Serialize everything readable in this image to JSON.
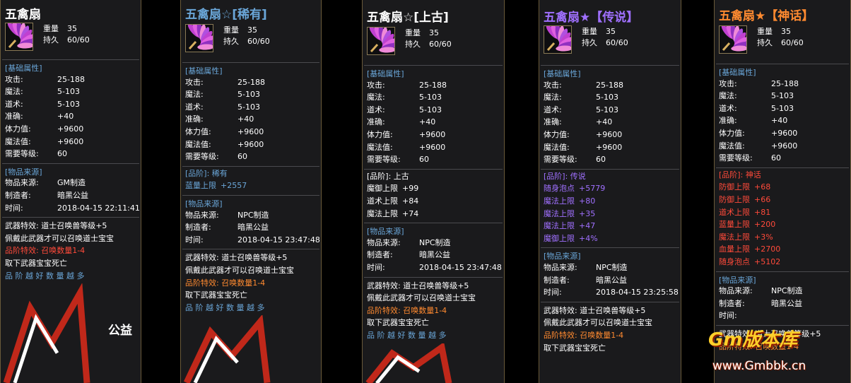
{
  "colors": {
    "white": "#ffffff",
    "blue": "#6aa6d8",
    "purple": "#a070ff",
    "orange": "#ff8a30",
    "red": "#ff4a3a",
    "cyan_title": "#8ab8ff"
  },
  "icon_name": "feather-fan-icon",
  "panels": [
    {
      "title": "五禽扇",
      "title_color": "#ffffff",
      "weight_label": "重量",
      "weight": "35",
      "durability_label": "持久",
      "durability": "60/60",
      "base_header": "[基础属性]",
      "stats": [
        {
          "label": "攻击:",
          "value": "25-188"
        },
        {
          "label": "魔法:",
          "value": "5-103"
        },
        {
          "label": "道术:",
          "value": "5-103"
        },
        {
          "label": "准确:",
          "value": "+40"
        },
        {
          "label": "体力值:",
          "value": "+9600"
        },
        {
          "label": "魔法值:",
          "value": "+9600"
        },
        {
          "label": "需要等级:",
          "value": "60"
        }
      ],
      "grade_lines": [],
      "source_header": "[物品来源]",
      "source": [
        {
          "label": "物品来源:",
          "value": "GM制造"
        },
        {
          "label": "制造者:",
          "value": "暗黑公益"
        },
        {
          "label": "时间:",
          "value": "2018-04-15 22:11:41"
        }
      ],
      "effects": [
        {
          "text": "武器特效: 道士召唤兽等级+5",
          "color": "#ffffff"
        },
        {
          "text": "佩戴此武器才可以召唤道士宝宝",
          "color": "#ffffff"
        },
        {
          "text": "品阶特效: 召唤数量1-4",
          "color": "#ff4a3a"
        },
        {
          "text": "取下武器宝宝死亡",
          "color": "#ffffff"
        },
        {
          "text": "品 阶 越 好 数 量 越 多",
          "color": "#6aa6d8"
        }
      ],
      "art_text": "公益"
    },
    {
      "title": "五禽扇☆[稀有]",
      "title_color": "#6aa6d8",
      "weight_label": "重量",
      "weight": "35",
      "durability_label": "持久",
      "durability": "60/60",
      "base_header": "[基础属性]",
      "stats": [
        {
          "label": "攻击:",
          "value": "25-188"
        },
        {
          "label": "魔法:",
          "value": "5-103"
        },
        {
          "label": "道术:",
          "value": "5-103"
        },
        {
          "label": "准确:",
          "value": "+40"
        },
        {
          "label": "体力值:",
          "value": "+9600"
        },
        {
          "label": "魔法值:",
          "value": "+9600"
        },
        {
          "label": "需要等级:",
          "value": "60"
        }
      ],
      "grade_lines": [
        {
          "label": "[品阶]: 稀有",
          "value": "",
          "color": "#6aa6d8"
        },
        {
          "label": "蓝量上限",
          "value": "+2557",
          "color": "#6aa6d8"
        }
      ],
      "source_header": "[物品来源]",
      "source": [
        {
          "label": "物品来源:",
          "value": "NPC制造"
        },
        {
          "label": "制造者:",
          "value": "暗黑公益"
        },
        {
          "label": "时间:",
          "value": "2018-04-15 23:47:48"
        }
      ],
      "effects": [
        {
          "text": "武器特效: 道士召唤兽等级+5",
          "color": "#ffffff"
        },
        {
          "text": "佩戴此武器才可以召唤道士宝宝",
          "color": "#ffffff"
        },
        {
          "text": "品阶特效: 召唤数量1-4",
          "color": "#ff8a30"
        },
        {
          "text": "取下武器宝宝死亡",
          "color": "#ffffff"
        },
        {
          "text": "品 阶 越 好 数 量 越 多",
          "color": "#6aa6d8"
        }
      ]
    },
    {
      "title": "五禽扇☆[上古]",
      "title_color": "#ffffff",
      "weight_label": "重量",
      "weight": "35",
      "durability_label": "持久",
      "durability": "60/60",
      "base_header": "[基础属性]",
      "stats": [
        {
          "label": "攻击:",
          "value": "25-188"
        },
        {
          "label": "魔法:",
          "value": "5-103"
        },
        {
          "label": "道术:",
          "value": "5-103"
        },
        {
          "label": "准确:",
          "value": "+40"
        },
        {
          "label": "体力值:",
          "value": "+9600"
        },
        {
          "label": "魔法值:",
          "value": "+9600"
        },
        {
          "label": "需要等级:",
          "value": "60"
        }
      ],
      "grade_lines": [
        {
          "label": "[品阶]: 上古",
          "value": "",
          "color": "#ffffff"
        },
        {
          "label": "魔御上限",
          "value": "+99",
          "color": "#ffffff"
        },
        {
          "label": "道术上限",
          "value": "+84",
          "color": "#ffffff"
        },
        {
          "label": "魔法上限",
          "value": "+74",
          "color": "#ffffff"
        }
      ],
      "source_header": "[物品来源]",
      "source": [
        {
          "label": "物品来源:",
          "value": "NPC制造"
        },
        {
          "label": "制造者:",
          "value": "暗黑公益"
        },
        {
          "label": "时间:",
          "value": "2018-04-15 23:47:48"
        }
      ],
      "effects": [
        {
          "text": "武器特效: 道士召唤兽等级+5",
          "color": "#ffffff"
        },
        {
          "text": "佩戴此武器才可以召唤道士宝宝",
          "color": "#ffffff"
        },
        {
          "text": "品阶特效: 召唤数量1-4",
          "color": "#ff8a30"
        },
        {
          "text": "取下武器宝宝死亡",
          "color": "#ffffff"
        },
        {
          "text": "品 阶 越 好 数 量 越 多",
          "color": "#6aa6d8"
        }
      ]
    },
    {
      "title": "五禽扇★【传说】",
      "title_color": "#a070ff",
      "weight_label": "重量",
      "weight": "35",
      "durability_label": "持久",
      "durability": "60/60",
      "base_header": "[基础属性]",
      "stats": [
        {
          "label": "攻击:",
          "value": "25-188"
        },
        {
          "label": "魔法:",
          "value": "5-103"
        },
        {
          "label": "道术:",
          "value": "5-103"
        },
        {
          "label": "准确:",
          "value": "+40"
        },
        {
          "label": "体力值:",
          "value": "+9600"
        },
        {
          "label": "魔法值:",
          "value": "+9600"
        },
        {
          "label": "需要等级:",
          "value": "60"
        }
      ],
      "grade_lines": [
        {
          "label": "[品阶]: 传说",
          "value": "",
          "color": "#a070ff"
        },
        {
          "label": "随身泡点",
          "value": "+5779",
          "color": "#a070ff"
        },
        {
          "label": "魔法上限",
          "value": "+80",
          "color": "#a070ff"
        },
        {
          "label": "魔法上限",
          "value": "+35",
          "color": "#a070ff"
        },
        {
          "label": "魔法上限",
          "value": "+47",
          "color": "#a070ff"
        },
        {
          "label": "魔御上限",
          "value": "+4%",
          "color": "#a070ff"
        }
      ],
      "source_header": "[物品来源]",
      "source": [
        {
          "label": "物品来源:",
          "value": "NPC制造"
        },
        {
          "label": "制造者:",
          "value": "暗黑公益"
        },
        {
          "label": "时间:",
          "value": "2018-04-15 23:25:58"
        }
      ],
      "effects": [
        {
          "text": "武器特效: 道士召唤兽等级+5",
          "color": "#ffffff"
        },
        {
          "text": "佩戴此武器才可以召唤道士宝宝",
          "color": "#ffffff"
        },
        {
          "text": "品阶特效: 召唤数量1-4",
          "color": "#ff8a30"
        },
        {
          "text": "取下武器宝宝死亡",
          "color": "#ffffff"
        }
      ]
    },
    {
      "title": "五禽扇★【神话】",
      "title_color": "#ff8a30",
      "weight_label": "重量",
      "weight": "35",
      "durability_label": "持久",
      "durability": "60/60",
      "base_header": "[基础属性]",
      "stats": [
        {
          "label": "攻击:",
          "value": "25-188"
        },
        {
          "label": "魔法:",
          "value": "5-103"
        },
        {
          "label": "道术:",
          "value": "5-103"
        },
        {
          "label": "准确:",
          "value": "+40"
        },
        {
          "label": "体力值:",
          "value": "+9600"
        },
        {
          "label": "魔法值:",
          "value": "+9600"
        },
        {
          "label": "需要等级:",
          "value": "60"
        }
      ],
      "grade_lines": [
        {
          "label": "[品阶]: 神话",
          "value": "",
          "color": "#ff4a3a"
        },
        {
          "label": "防御上限",
          "value": "+68",
          "color": "#ff4a3a"
        },
        {
          "label": "防御上限",
          "value": "+66",
          "color": "#ff4a3a"
        },
        {
          "label": "道术上限",
          "value": "+81",
          "color": "#ff4a3a"
        },
        {
          "label": "蓝量上限",
          "value": "+200",
          "color": "#ff4a3a"
        },
        {
          "label": "魔法上限",
          "value": "+3%",
          "color": "#ff4a3a"
        },
        {
          "label": "血量上限",
          "value": "+2700",
          "color": "#ff4a3a"
        },
        {
          "label": "随身泡点",
          "value": "+5102",
          "color": "#ff4a3a"
        }
      ],
      "source_header": "[物品来源]",
      "source": [
        {
          "label": "物品来源:",
          "value": "NPC制造"
        },
        {
          "label": "制造者:",
          "value": "暗黑公益"
        },
        {
          "label": "时间:",
          "value": ""
        }
      ],
      "effects": [
        {
          "text": "武器特效: 道士召唤兽等级+5",
          "color": "#ffffff"
        },
        {
          "text": "品阶特效: 召唤数量1-4",
          "color": "#ff8a30"
        }
      ]
    }
  ],
  "watermark": {
    "logo": "Gm版本库",
    "url": "www.Gmbbk.cn"
  }
}
